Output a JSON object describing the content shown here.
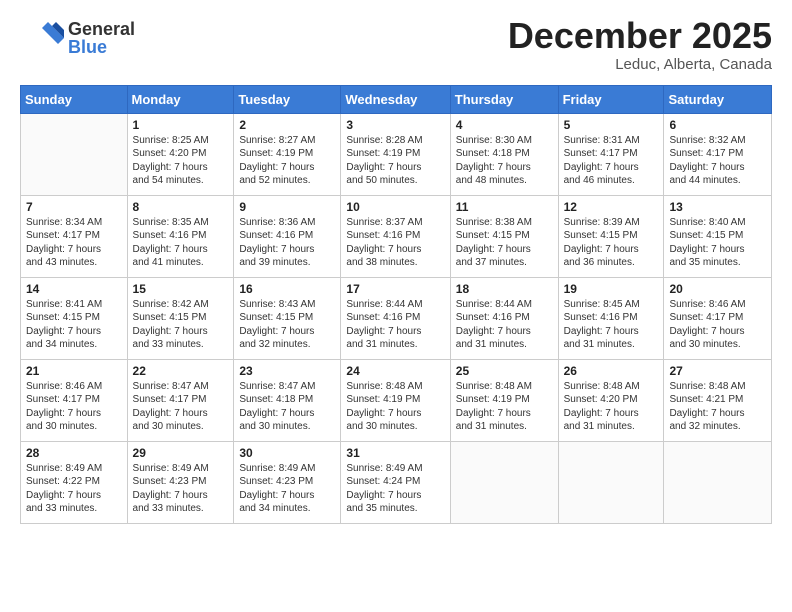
{
  "logo": {
    "general": "General",
    "blue": "Blue"
  },
  "header": {
    "month": "December 2025",
    "location": "Leduc, Alberta, Canada"
  },
  "weekdays": [
    "Sunday",
    "Monday",
    "Tuesday",
    "Wednesday",
    "Thursday",
    "Friday",
    "Saturday"
  ],
  "weeks": [
    [
      {
        "day": "",
        "info": ""
      },
      {
        "day": "1",
        "info": "Sunrise: 8:25 AM\nSunset: 4:20 PM\nDaylight: 7 hours\nand 54 minutes."
      },
      {
        "day": "2",
        "info": "Sunrise: 8:27 AM\nSunset: 4:19 PM\nDaylight: 7 hours\nand 52 minutes."
      },
      {
        "day": "3",
        "info": "Sunrise: 8:28 AM\nSunset: 4:19 PM\nDaylight: 7 hours\nand 50 minutes."
      },
      {
        "day": "4",
        "info": "Sunrise: 8:30 AM\nSunset: 4:18 PM\nDaylight: 7 hours\nand 48 minutes."
      },
      {
        "day": "5",
        "info": "Sunrise: 8:31 AM\nSunset: 4:17 PM\nDaylight: 7 hours\nand 46 minutes."
      },
      {
        "day": "6",
        "info": "Sunrise: 8:32 AM\nSunset: 4:17 PM\nDaylight: 7 hours\nand 44 minutes."
      }
    ],
    [
      {
        "day": "7",
        "info": "Sunrise: 8:34 AM\nSunset: 4:17 PM\nDaylight: 7 hours\nand 43 minutes."
      },
      {
        "day": "8",
        "info": "Sunrise: 8:35 AM\nSunset: 4:16 PM\nDaylight: 7 hours\nand 41 minutes."
      },
      {
        "day": "9",
        "info": "Sunrise: 8:36 AM\nSunset: 4:16 PM\nDaylight: 7 hours\nand 39 minutes."
      },
      {
        "day": "10",
        "info": "Sunrise: 8:37 AM\nSunset: 4:16 PM\nDaylight: 7 hours\nand 38 minutes."
      },
      {
        "day": "11",
        "info": "Sunrise: 8:38 AM\nSunset: 4:15 PM\nDaylight: 7 hours\nand 37 minutes."
      },
      {
        "day": "12",
        "info": "Sunrise: 8:39 AM\nSunset: 4:15 PM\nDaylight: 7 hours\nand 36 minutes."
      },
      {
        "day": "13",
        "info": "Sunrise: 8:40 AM\nSunset: 4:15 PM\nDaylight: 7 hours\nand 35 minutes."
      }
    ],
    [
      {
        "day": "14",
        "info": "Sunrise: 8:41 AM\nSunset: 4:15 PM\nDaylight: 7 hours\nand 34 minutes."
      },
      {
        "day": "15",
        "info": "Sunrise: 8:42 AM\nSunset: 4:15 PM\nDaylight: 7 hours\nand 33 minutes."
      },
      {
        "day": "16",
        "info": "Sunrise: 8:43 AM\nSunset: 4:15 PM\nDaylight: 7 hours\nand 32 minutes."
      },
      {
        "day": "17",
        "info": "Sunrise: 8:44 AM\nSunset: 4:16 PM\nDaylight: 7 hours\nand 31 minutes."
      },
      {
        "day": "18",
        "info": "Sunrise: 8:44 AM\nSunset: 4:16 PM\nDaylight: 7 hours\nand 31 minutes."
      },
      {
        "day": "19",
        "info": "Sunrise: 8:45 AM\nSunset: 4:16 PM\nDaylight: 7 hours\nand 31 minutes."
      },
      {
        "day": "20",
        "info": "Sunrise: 8:46 AM\nSunset: 4:17 PM\nDaylight: 7 hours\nand 30 minutes."
      }
    ],
    [
      {
        "day": "21",
        "info": "Sunrise: 8:46 AM\nSunset: 4:17 PM\nDaylight: 7 hours\nand 30 minutes."
      },
      {
        "day": "22",
        "info": "Sunrise: 8:47 AM\nSunset: 4:17 PM\nDaylight: 7 hours\nand 30 minutes."
      },
      {
        "day": "23",
        "info": "Sunrise: 8:47 AM\nSunset: 4:18 PM\nDaylight: 7 hours\nand 30 minutes."
      },
      {
        "day": "24",
        "info": "Sunrise: 8:48 AM\nSunset: 4:19 PM\nDaylight: 7 hours\nand 30 minutes."
      },
      {
        "day": "25",
        "info": "Sunrise: 8:48 AM\nSunset: 4:19 PM\nDaylight: 7 hours\nand 31 minutes."
      },
      {
        "day": "26",
        "info": "Sunrise: 8:48 AM\nSunset: 4:20 PM\nDaylight: 7 hours\nand 31 minutes."
      },
      {
        "day": "27",
        "info": "Sunrise: 8:48 AM\nSunset: 4:21 PM\nDaylight: 7 hours\nand 32 minutes."
      }
    ],
    [
      {
        "day": "28",
        "info": "Sunrise: 8:49 AM\nSunset: 4:22 PM\nDaylight: 7 hours\nand 33 minutes."
      },
      {
        "day": "29",
        "info": "Sunrise: 8:49 AM\nSunset: 4:23 PM\nDaylight: 7 hours\nand 33 minutes."
      },
      {
        "day": "30",
        "info": "Sunrise: 8:49 AM\nSunset: 4:23 PM\nDaylight: 7 hours\nand 34 minutes."
      },
      {
        "day": "31",
        "info": "Sunrise: 8:49 AM\nSunset: 4:24 PM\nDaylight: 7 hours\nand 35 minutes."
      },
      {
        "day": "",
        "info": ""
      },
      {
        "day": "",
        "info": ""
      },
      {
        "day": "",
        "info": ""
      }
    ]
  ]
}
